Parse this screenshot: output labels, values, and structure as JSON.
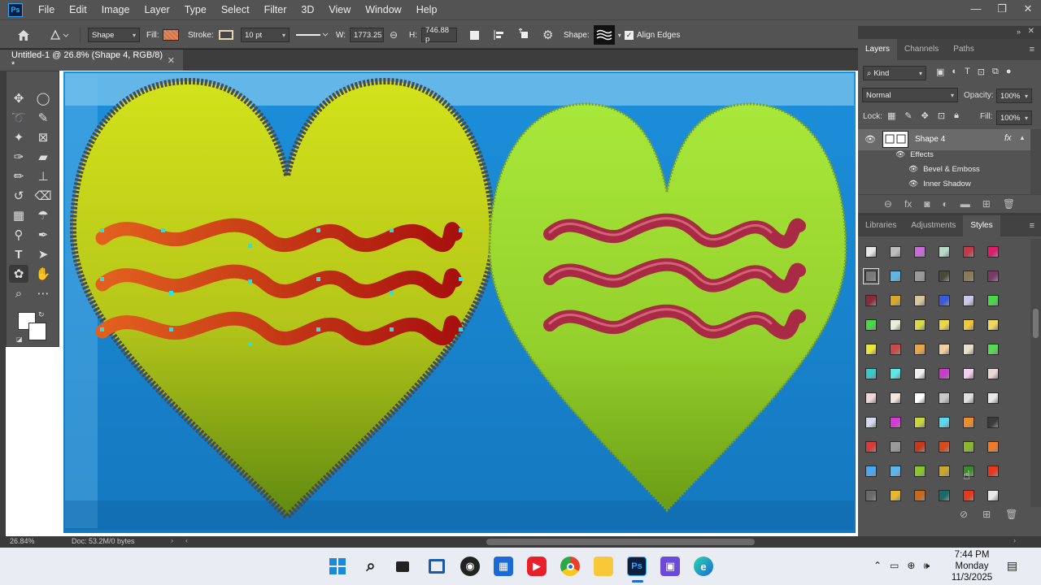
{
  "app": {
    "logo": "Ps"
  },
  "menu": [
    "File",
    "Edit",
    "Image",
    "Layer",
    "Type",
    "Select",
    "Filter",
    "3D",
    "View",
    "Window",
    "Help"
  ],
  "window_controls": {
    "minimize": "—",
    "restore": "❐",
    "close": "✕"
  },
  "options": {
    "mode": "Shape",
    "fill_label": "Fill:",
    "fill_color": "#e2885e",
    "stroke_label": "Stroke:",
    "stroke_size": "10 pt",
    "w_label": "W:",
    "w_value": "1773.25",
    "h_label": "H:",
    "h_value": "746.88 p",
    "shape_label": "Shape:",
    "align_edges": "Align Edges"
  },
  "document_tab": {
    "title": "Untitled-1 @ 26.8% (Shape 4, RGB/8) *",
    "close": "✕"
  },
  "status": {
    "zoom": "26.84%",
    "doc": "Doc: 53.2M/0 bytes"
  },
  "layers_panel": {
    "tabs": [
      "Layers",
      "Channels",
      "Paths"
    ],
    "active_tab": "Layers",
    "filter": "Kind",
    "blend_mode": "Normal",
    "opacity_label": "Opacity:",
    "opacity": "100%",
    "lock_label": "Lock:",
    "fill_label": "Fill:",
    "fill": "100%",
    "layer_name": "Shape 4",
    "effects_label": "Effects",
    "effects": [
      "Bevel & Emboss",
      "Inner Shadow"
    ],
    "fx": "fx"
  },
  "styles_panel": {
    "tabs": [
      "Libraries",
      "Adjustments",
      "Styles"
    ],
    "active_tab": "Styles",
    "swatches": [
      [
        "#e8e8e8",
        "#bdbdbd",
        "#c86ad8",
        "#b8d8c8",
        "#c23a4a",
        "#e01a6a"
      ],
      [
        "#7a7a7a",
        "#5fb7e8",
        "#9a9a9a",
        "#4a4a3a",
        "#8a7a5a",
        "#7a3a6a"
      ],
      [
        "#8a2a3a",
        "#d8a82a",
        "#d8c8a0",
        "#3a5ad8",
        "#c8c8e8",
        "#4ad84a"
      ],
      [
        "#4ad84a",
        "#e8f0d8",
        "#d8d84a",
        "#e8d84a",
        "#f0c838",
        "#f0d860"
      ],
      [
        "#e8e83a",
        "#c84a4a",
        "#e8a84a",
        "#f0d0a0",
        "#e8e0c8",
        "#58d858"
      ],
      [
        "#3ac8c8",
        "#5ae8e8",
        "#f0f0f0",
        "#c83ac8",
        "#f0d0f0",
        "#e8d8d8"
      ],
      [
        "#f0d8d8",
        "#f0e8e0",
        "#ffffff",
        "#c8c8c8",
        "#e0e0e0",
        "#e8e8e8"
      ],
      [
        "#d8d8f0",
        "#d83ad8",
        "#c8d838",
        "#5ad8f0",
        "#f08a2a",
        "#3a3a3a"
      ],
      [
        "#d83a3a",
        "#9a9a9a",
        "#c8381a",
        "#d84a1a",
        "#8ab82a",
        "#f07a2a"
      ],
      [
        "#4aa8f0",
        "#5ab8f0",
        "#8ac82a",
        "#c8a82a",
        "#3a8a2a",
        "#e8381a"
      ],
      [
        "#6a6a6a",
        "#e8b82a",
        "#c8681a",
        "#1a6a6a",
        "#e8381a",
        "#e8e8e8"
      ]
    ]
  },
  "taskbar": {
    "time": "7:44 PM",
    "day": "Monday",
    "date": "11/3/2025",
    "apps": [
      "start-icon",
      "search-icon",
      "task-view-icon",
      "widgets-icon",
      "github-icon",
      "store-icon",
      "youtube-icon",
      "chrome-icon",
      "file-explorer-icon",
      "photoshop-icon",
      "teams-icon",
      "edge-icon"
    ]
  },
  "colors": {
    "accent": "#31a8ff",
    "canvas_bg": "#1987d1",
    "heart_left": "#c8d81e",
    "heart_right": "#9ad832",
    "wave_left": "#d8501e",
    "wave_right": "#b83048"
  }
}
